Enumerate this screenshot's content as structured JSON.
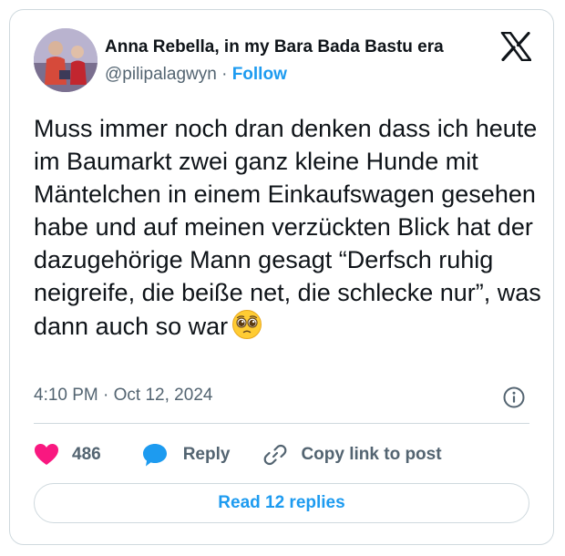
{
  "author": {
    "display_name": "Anna Rebella, in my Bara Bada Bastu era",
    "handle": "@pilipalagwyn",
    "separator": "·",
    "follow_label": "Follow"
  },
  "tweet": {
    "text": "Muss immer noch dran denken dass ich heute im Baumarkt zwei ganz kleine Hunde mit Mäntelchen in einem Einkaufswagen gesehen habe und auf meinen verzückten Blick hat der dazugehörige Mann gesagt “Derfsch ruhig neigreife, die beiße net, die schlecke nur”, was dann auch so war",
    "emoji": "pleading-face-emoji",
    "time": "4:10 PM",
    "separator": "·",
    "date": "Oct 12, 2024"
  },
  "actions": {
    "like_count": "486",
    "reply_label": "Reply",
    "copy_link_label": "Copy link to post"
  },
  "read_replies_label": "Read 12 replies",
  "icons": {
    "brand": "x-logo-icon",
    "info": "info-icon",
    "like": "heart-icon",
    "reply": "speech-bubble-icon",
    "copy": "link-icon"
  },
  "colors": {
    "text": "#0f1419",
    "muted": "#536471",
    "accent": "#1d9bf0",
    "like": "#f91880",
    "border": "#cfd9de"
  }
}
